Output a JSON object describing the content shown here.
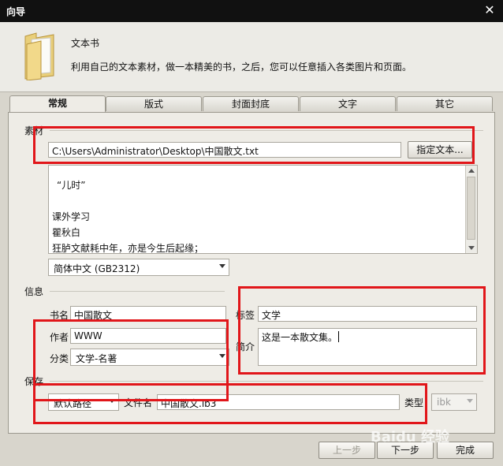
{
  "window": {
    "title": "向导",
    "close_glyph": "✕"
  },
  "header": {
    "name": "文本书",
    "description": "利用自己的文本素材，做一本精美的书，之后，您可以任意插入各类图片和页面。",
    "icon": "folder-icon"
  },
  "tabs": [
    {
      "label": "常规",
      "active": true
    },
    {
      "label": "版式",
      "active": false
    },
    {
      "label": "封面封底",
      "active": false
    },
    {
      "label": "文字",
      "active": false
    },
    {
      "label": "其它",
      "active": false
    }
  ],
  "material": {
    "section_label": "素材",
    "file_path": "C:\\Users\\Administrator\\Desktop\\中国散文.txt",
    "choose_button": "指定文本...",
    "preview_lines": [
      "“儿时”",
      "",
      "课外学习",
      "瞿秋白",
      "狂胪文献耗中年，亦是今生后起缘；"
    ],
    "encoding": "简体中文 (GB2312)"
  },
  "info": {
    "section_label": "信息",
    "title_label": "书名",
    "title_value": "中国散文",
    "author_label": "作者",
    "author_value": "WWW",
    "category_label": "分类",
    "category_value": "文学-名著",
    "tag_label": "标签",
    "tag_value": "文学",
    "summary_label": "简介",
    "summary_value": "这是一本散文集。"
  },
  "save": {
    "section_label": "保存",
    "path_option": "默认路径",
    "filename_label": "文件名",
    "filename_value": "中国散文.ib3",
    "type_label": "类型",
    "type_value": "ibk"
  },
  "footer": {
    "prev_button": "上一步",
    "next_button": "下一步",
    "finish_button": "完成"
  },
  "watermark_text": "Baidu 经验",
  "highlight_color": "#e1161a"
}
